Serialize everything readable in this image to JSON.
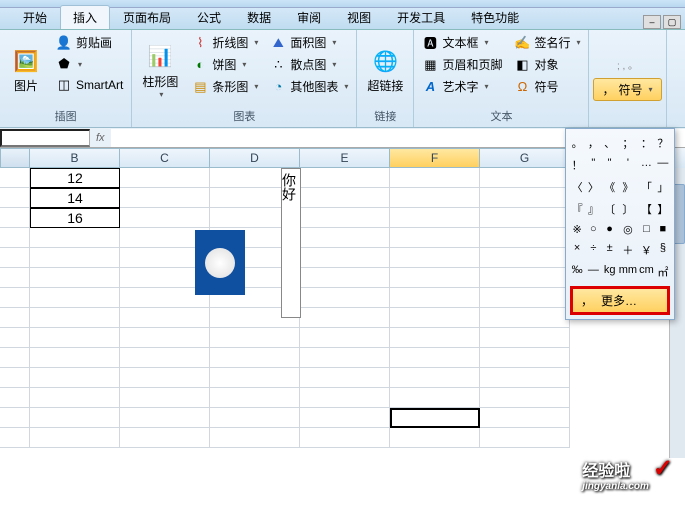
{
  "tabs": {
    "items": [
      "开始",
      "插入",
      "页面布局",
      "公式",
      "数据",
      "审阅",
      "视图",
      "开发工具",
      "特色功能"
    ],
    "active_index": 1
  },
  "ribbon": {
    "groups": {
      "illustrations": {
        "label": "插图",
        "picture": "图片",
        "clipart": "剪贴画",
        "smartart": "SmartArt"
      },
      "charts": {
        "label": "图表",
        "column": "柱形图",
        "line": "折线图",
        "pie": "饼图",
        "bar": "条形图",
        "area": "面积图",
        "scatter": "散点图",
        "other": "其他图表"
      },
      "links": {
        "label": "链接",
        "hyperlink": "超链接"
      },
      "text": {
        "label": "文本",
        "textbox": "文本框",
        "header_footer": "页眉和页脚",
        "wordart": "艺术字",
        "signature": "签名行",
        "object": "对象",
        "symbol_item": "符号"
      },
      "symbol": {
        "label": "符号"
      }
    }
  },
  "formula_bar": {
    "fx": "fx",
    "value": ""
  },
  "columns": [
    "B",
    "C",
    "D",
    "E",
    "F",
    "G"
  ],
  "selected_col_index": 4,
  "cells": {
    "b1": "12",
    "b2": "14",
    "b3": "16"
  },
  "textbox_content": "你好",
  "symbol_popup": {
    "rows": [
      [
        "。",
        "，",
        "、",
        "；",
        "：",
        "？"
      ],
      [
        "！",
        "\"",
        "\"",
        "'",
        "…",
        "—"
      ],
      [
        "〈",
        "〉",
        "《",
        "》",
        "「",
        "」"
      ],
      [
        "『",
        "』",
        "〔",
        "〕",
        "【",
        "】"
      ],
      [
        "※",
        "○",
        "●",
        "◎",
        "□",
        "■"
      ],
      [
        "×",
        "÷",
        "±",
        "＋",
        "￥",
        "§"
      ],
      [
        "‰",
        "—",
        "kg",
        "mm",
        "cm",
        "㎡"
      ]
    ],
    "more_label": "更多…",
    "more_prefix": "，"
  },
  "watermark": {
    "main": "经验啦",
    "sub": "jingyanla.com"
  }
}
